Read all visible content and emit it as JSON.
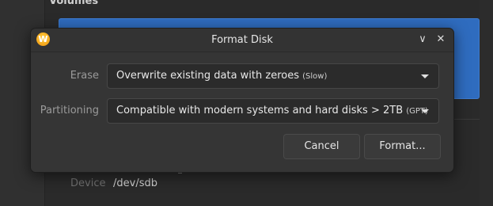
{
  "background": {
    "volumes_title": "Volumes",
    "device_label": "Device",
    "device_value": "/dev/sdb"
  },
  "dialog": {
    "title": "Format Disk",
    "app_icon_letter": "W",
    "minimize_symbol": "∨",
    "close_symbol": "✕",
    "erase": {
      "label": "Erase",
      "value": "Overwrite existing data with zeroes",
      "hint": "(Slow)"
    },
    "partitioning": {
      "label": "Partitioning",
      "value": "Compatible with modern systems and hard disks > 2TB",
      "hint": "(GPT)"
    },
    "cancel_label": "Cancel",
    "format_label": "Format..."
  },
  "colors": {
    "accent_volume": "#2f6cbf",
    "app_icon": "#f4a51c",
    "dialog_bg": "#353535"
  }
}
